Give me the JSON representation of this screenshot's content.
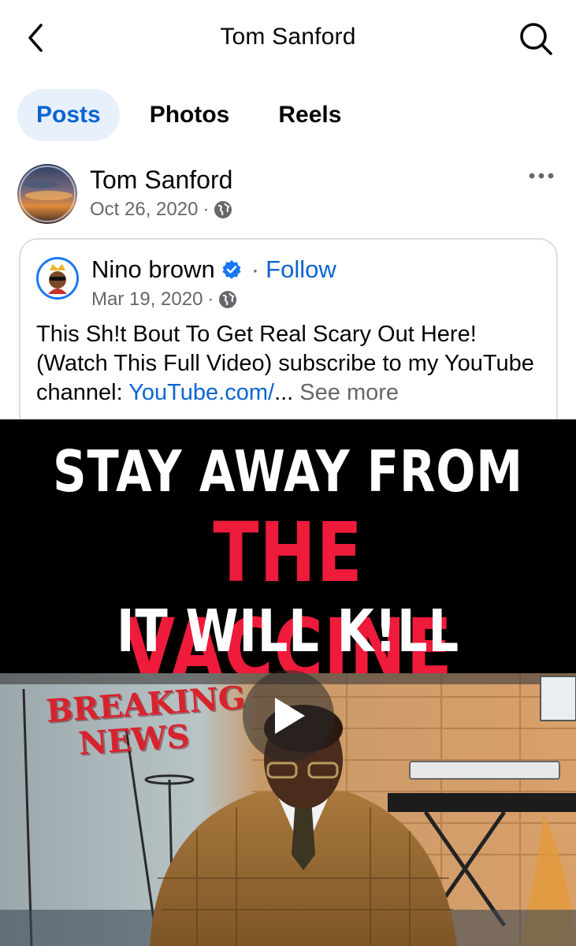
{
  "header": {
    "title": "Tom Sanford"
  },
  "tabs": [
    {
      "label": "Posts",
      "active": true
    },
    {
      "label": "Photos",
      "active": false
    },
    {
      "label": "Reels",
      "active": false
    }
  ],
  "post": {
    "author": "Tom Sanford",
    "date": "Oct 26, 2020",
    "separator": "·",
    "shared": {
      "author": "Nino brown",
      "separator": "·",
      "follow_label": "Follow",
      "date": "Mar 19, 2020",
      "text": "This Sh!t Bout To Get Real Scary Out Here! (Watch This Full Video) subscribe to my YouTube channel: ",
      "link_text": "YouTube.com/",
      "ellipsis": "...",
      "see_more_label": "See more"
    },
    "video": {
      "line1": "STAY AWAY FROM",
      "line2": "THE VACCINE",
      "line3": "IT WILL K!LL YOU",
      "overlay_line1": "BREAKING",
      "overlay_line2": "NEWS"
    }
  },
  "colors": {
    "accent": "#0a64d2",
    "tab_active_bg": "#e7f0fb",
    "banner_red": "#ee1b3a",
    "meta_gray": "#65676b"
  },
  "icons": [
    "back-arrow-icon",
    "search-icon",
    "globe-icon",
    "more-options-icon",
    "verified-badge-icon",
    "play-icon"
  ]
}
